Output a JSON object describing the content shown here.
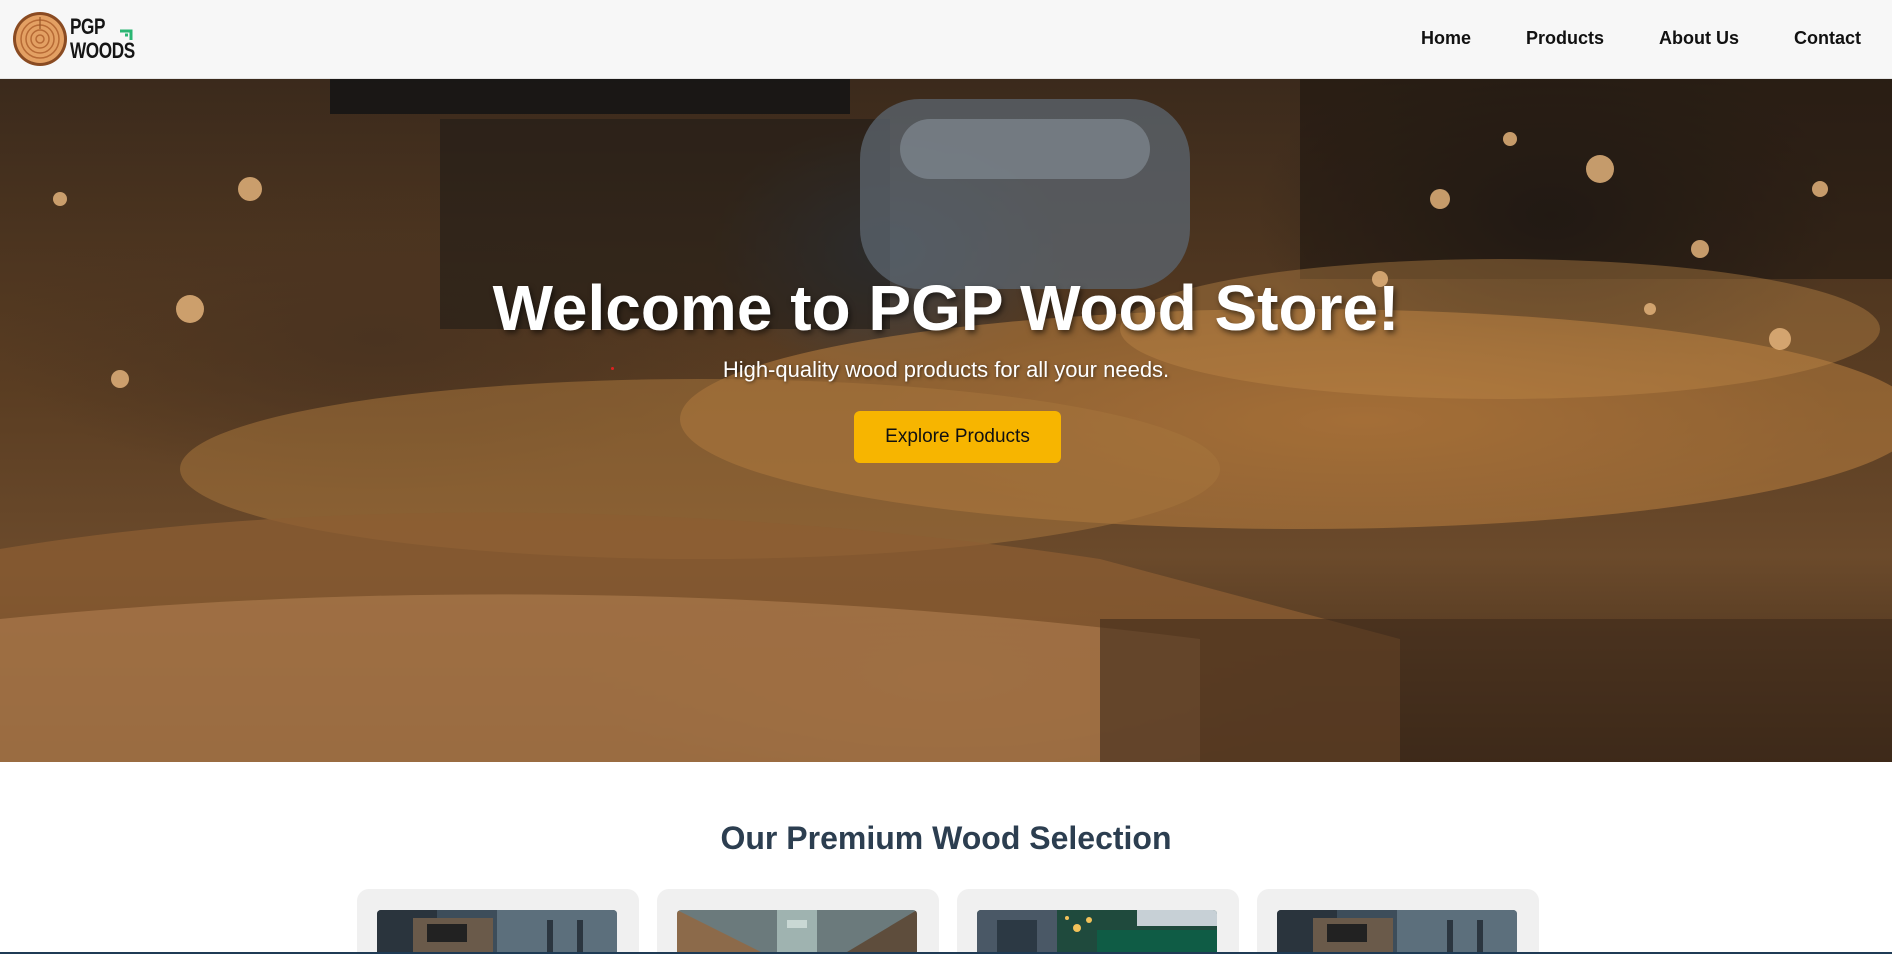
{
  "brand": {
    "logo_lines": [
      "PGP",
      "WOODS"
    ],
    "logo_icon": "wood-log-icon",
    "accent_color": "#2bb673"
  },
  "nav": {
    "items": [
      {
        "label": "Home"
      },
      {
        "label": "Products"
      },
      {
        "label": "About Us"
      },
      {
        "label": "Contact"
      }
    ]
  },
  "hero": {
    "title": "Welcome to PGP Wood Store!",
    "subtitle": "High-quality wood products for all your needs.",
    "cta_label": "Explore Products",
    "cta_color": "#f7b500",
    "background": "wood-shavings-photo"
  },
  "products": {
    "section_title": "Our Premium Wood Selection",
    "cards": [
      {
        "image": "sawmill-machine-photo"
      },
      {
        "image": "warehouse-lumber-photo"
      },
      {
        "image": "green-machine-sparks-photo"
      },
      {
        "image": "sawmill-machine-photo"
      }
    ]
  },
  "colors": {
    "header_bg": "#f7f7f7",
    "section_title": "#2c3e50",
    "card_bg": "#f0f0f0"
  }
}
